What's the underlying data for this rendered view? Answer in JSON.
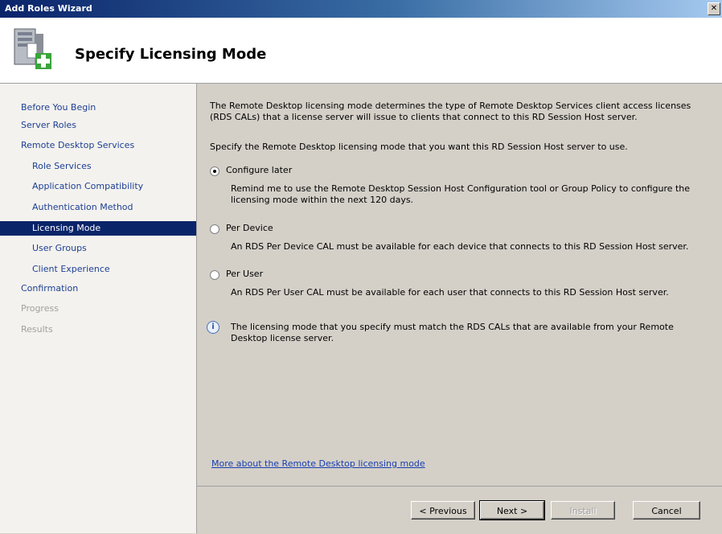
{
  "window": {
    "title": "Add Roles Wizard",
    "close_glyph": "✕"
  },
  "header": {
    "title": "Specify Licensing Mode",
    "icon": "server-roles-add-icon"
  },
  "sidebar": {
    "items": [
      {
        "label": "Before You Begin"
      },
      {
        "label": "Server Roles"
      },
      {
        "label": "Remote Desktop Services"
      },
      {
        "label": "Role Services"
      },
      {
        "label": "Application Compatibility"
      },
      {
        "label": "Authentication Method"
      },
      {
        "label": "Licensing Mode"
      },
      {
        "label": "User Groups"
      },
      {
        "label": "Client Experience"
      },
      {
        "label": "Confirmation"
      },
      {
        "label": "Progress"
      },
      {
        "label": "Results"
      }
    ]
  },
  "content": {
    "intro": "The Remote Desktop licensing mode determines the type of Remote Desktop Services client access licenses (RDS CALs) that a license server will issue to clients that connect to this RD Session Host server.",
    "prompt": "Specify the Remote Desktop licensing mode that you want this RD Session Host server to use.",
    "options": [
      {
        "label": "Configure later",
        "description": "Remind me to use the Remote Desktop Session Host Configuration tool or Group Policy to configure the licensing mode within the next 120 days.",
        "selected": true
      },
      {
        "label": "Per Device",
        "description": "An RDS Per Device CAL must be available for each device that connects to this RD Session Host server.",
        "selected": false
      },
      {
        "label": "Per User",
        "description": "An RDS Per User CAL must be available for each user that connects to this RD Session Host server.",
        "selected": false
      }
    ],
    "info_icon_glyph": "i",
    "info": "The licensing mode that you specify must match the RDS CALs that are available from your Remote Desktop license server.",
    "help_link": "More about the Remote Desktop licensing mode"
  },
  "footer": {
    "previous": "< Previous",
    "next": "Next >",
    "install": "Install",
    "cancel": "Cancel"
  }
}
